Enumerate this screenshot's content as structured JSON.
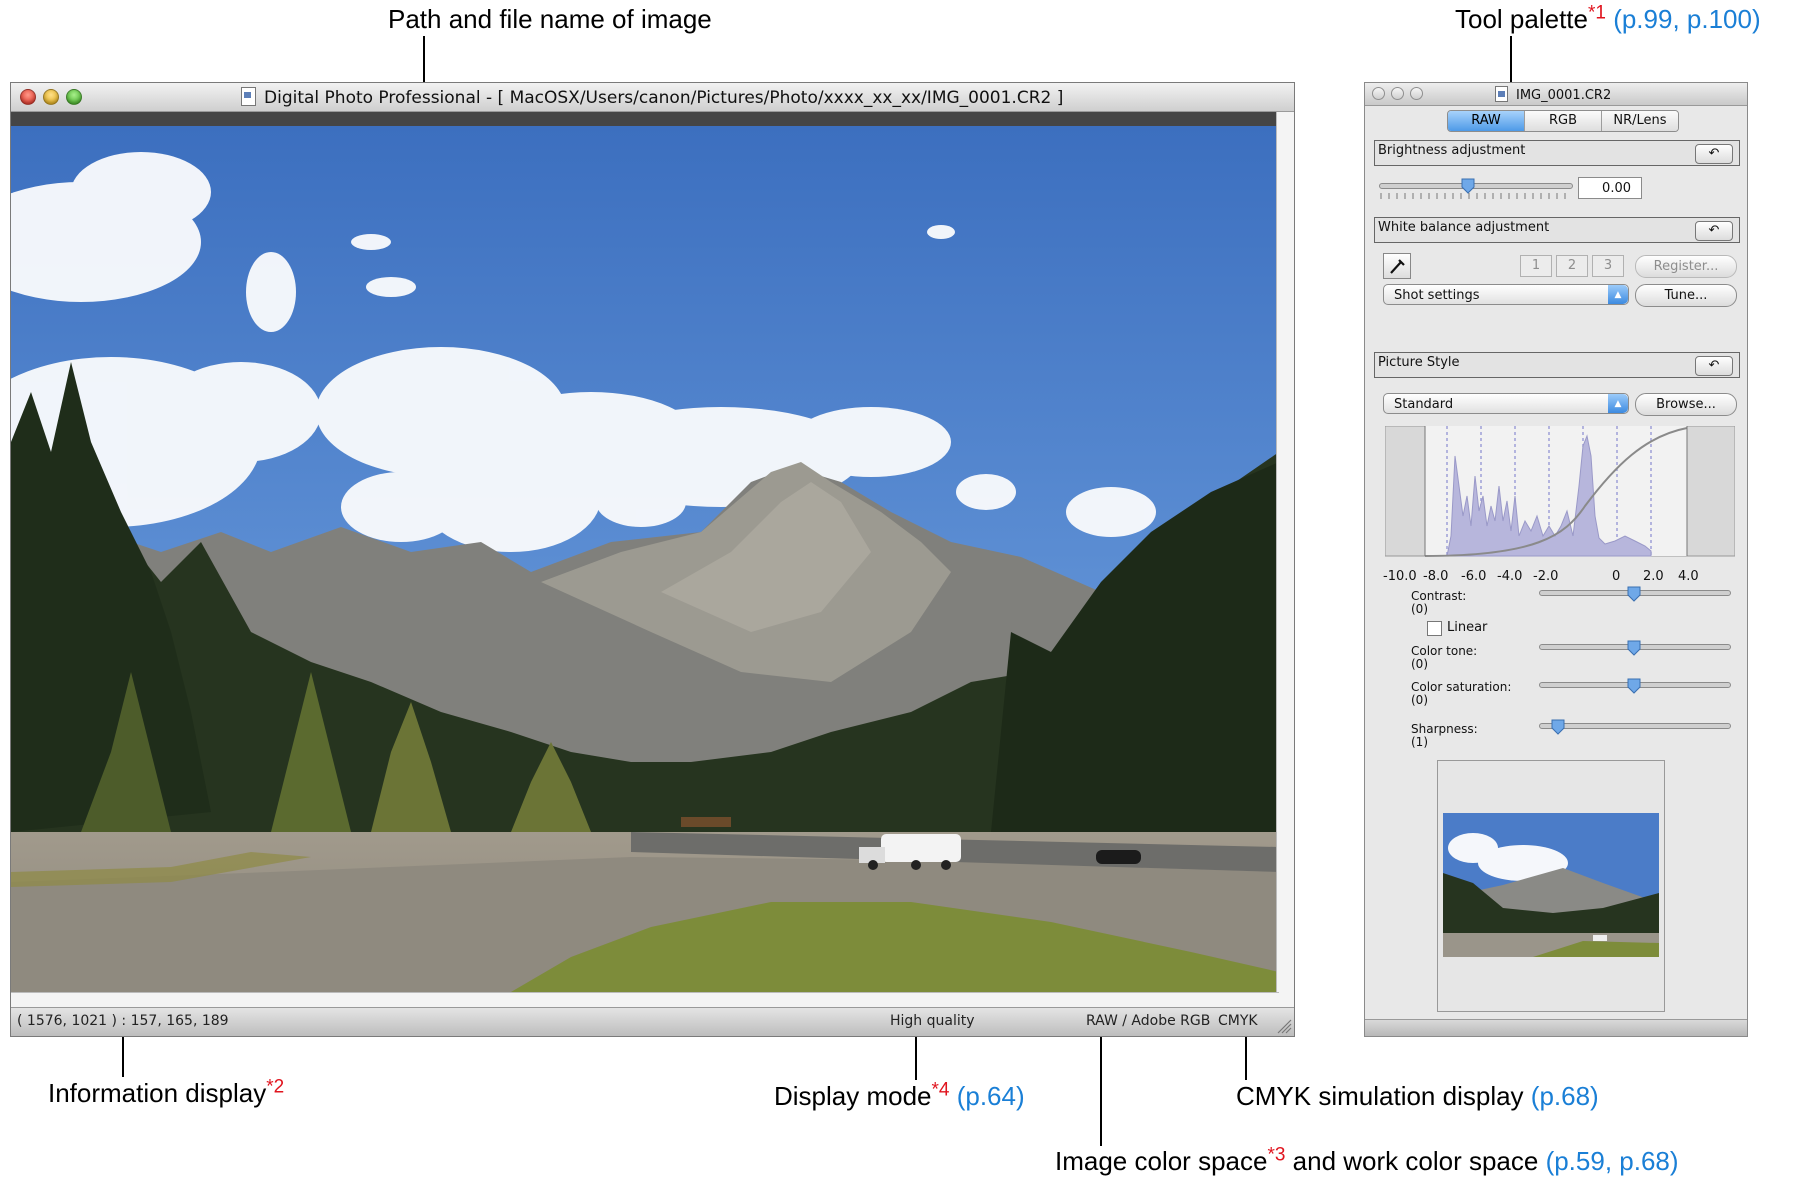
{
  "annotations": {
    "path_label": "Path and file name of image",
    "tool_palette": {
      "text": "Tool palette",
      "star": "*1",
      "ref": "(p.99, p.100)"
    },
    "info_display": {
      "text": "Information display",
      "star": "*2"
    },
    "display_mode": {
      "text": "Display mode",
      "star": "*4",
      "ref": "(p.64)"
    },
    "cmyk_display": {
      "text": "CMYK simulation display",
      "ref": "(p.68)"
    },
    "color_space": {
      "text_a": "Image color space",
      "star": "*3",
      "text_b": " and work color space",
      "ref": "(p.59, p.68)"
    }
  },
  "main_window": {
    "title": "Digital Photo Professional - [ MacOSX/Users/canon/Pictures/Photo/xxxx_xx_xx/IMG_0001.CR2 ]",
    "status": {
      "info": "( 1576, 1021 ) : 157, 165, 189",
      "quality": "High quality",
      "color_space": "RAW / Adobe RGB",
      "cmyk": "CMYK"
    }
  },
  "palette": {
    "title": "IMG_0001.CR2",
    "tabs": [
      "RAW",
      "RGB",
      "NR/Lens"
    ],
    "active_tab": "RAW",
    "brightness": {
      "label": "Brightness adjustment",
      "value": "0.00"
    },
    "white_balance": {
      "label": "White balance adjustment",
      "presets": [
        "1",
        "2",
        "3"
      ],
      "register": "Register...",
      "setting": "Shot settings",
      "tune": "Tune..."
    },
    "picture_style": {
      "label": "Picture Style",
      "style": "Standard",
      "browse": "Browse...",
      "histogram_ticks": [
        "-10.0",
        "-8.0",
        "-6.0",
        "-4.0",
        "-2.0",
        "0",
        "2.0",
        "4.0"
      ],
      "sliders": [
        {
          "label": "Contrast:",
          "value": "(0)"
        },
        {
          "label": "Color tone:",
          "value": "(0)"
        },
        {
          "label": "Color saturation:",
          "value": "(0)"
        },
        {
          "label": "Sharpness:",
          "value": "(1)"
        }
      ],
      "linear_label": "Linear"
    }
  },
  "colors": {
    "accent_blue": "#4e9ae8",
    "annotation_ref": "#1a7fd6",
    "annotation_star": "#e0141e",
    "histogram_fill": "#b7b6dc"
  }
}
